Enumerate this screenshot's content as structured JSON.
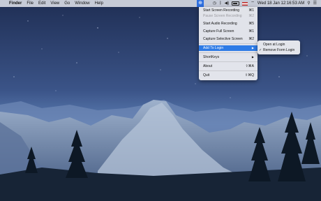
{
  "menubar": {
    "apple_glyph": "",
    "app_name": "Finder",
    "menus": [
      "File",
      "Edit",
      "View",
      "Go",
      "Window",
      "Help"
    ],
    "datetime": "Wed 18 Jan  12:16:53 AM",
    "app_icon_glyph": "⊕"
  },
  "menu": {
    "start_screen_recording": {
      "label": "Start Screen Recording",
      "shortcut": "⌘1"
    },
    "pause_screen_recording": {
      "label": "Pause Screen Recording",
      "shortcut": "⌘2"
    },
    "start_audio_recording": {
      "label": "Start Audio Recording",
      "shortcut": "⌘5"
    },
    "capture_full_screen": {
      "label": "Capture Full Screen",
      "shortcut": "⌘1"
    },
    "capture_selective_screen": {
      "label": "Capture Selective Screen",
      "shortcut": "⌘2"
    },
    "add_to_login": {
      "label": "Add To Login",
      "arrow": "▶"
    },
    "shortkeys": {
      "label": "ShortKeys",
      "arrow": "▶"
    },
    "about": {
      "label": "About",
      "shortcut": "⇧⌘A"
    },
    "quit": {
      "label": "Quit",
      "shortcut": "⇧⌘Q"
    }
  },
  "submenu": {
    "open_at_login": "Open at Login",
    "remove_form_login": "Remove Form Login",
    "check_glyph": "✓"
  },
  "colors": {
    "selection": "#2e7be6",
    "menubar": "#eceef4"
  }
}
